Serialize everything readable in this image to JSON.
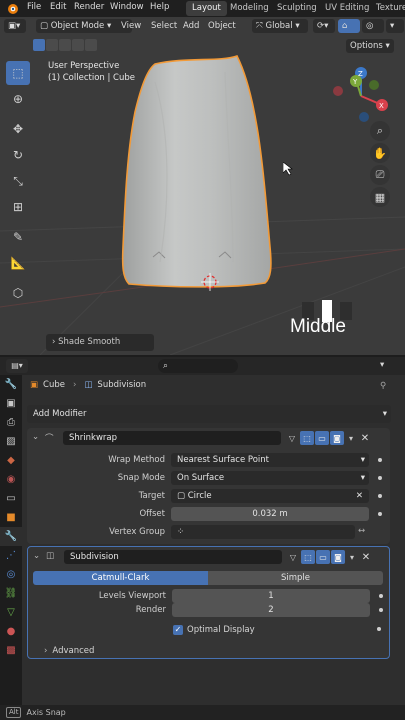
{
  "menu": [
    "File",
    "Edit",
    "Render",
    "Window",
    "Help"
  ],
  "workspaces": [
    "Layout",
    "Modeling",
    "Sculpting",
    "UV Editing",
    "Texture"
  ],
  "active_workspace": "Layout",
  "viewport": {
    "mode": "Object Mode",
    "header_menus": [
      "View",
      "Select",
      "Add",
      "Object"
    ],
    "transform": "Global",
    "options": "Options",
    "perspective": "User Perspective",
    "collection": "(1) Collection | Cube",
    "shade_panel": "Shade Smooth",
    "mouse_label": "Middle",
    "gizmo_axes": {
      "x": "X",
      "y": "Y",
      "z": "Z"
    }
  },
  "properties": {
    "breadcrumb_object": "Cube",
    "breadcrumb_modifier": "Subdivision",
    "add_modifier": "Add Modifier",
    "shrinkwrap": {
      "name": "Shrinkwrap",
      "wrap_method_label": "Wrap Method",
      "wrap_method": "Nearest Surface Point",
      "snap_mode_label": "Snap Mode",
      "snap_mode": "On Surface",
      "target_label": "Target",
      "target": "Circle",
      "offset_label": "Offset",
      "offset": "0.032 m",
      "vertex_group_label": "Vertex Group",
      "vertex_group": ""
    },
    "subdivision": {
      "name": "Subdivision",
      "tab_catmull": "Catmull-Clark",
      "tab_simple": "Simple",
      "levels_viewport_label": "Levels Viewport",
      "levels_viewport": "1",
      "render_label": "Render",
      "render": "2",
      "optimal_display": "Optimal Display",
      "advanced": "Advanced"
    }
  },
  "status": {
    "key": "Alt",
    "text": "Axis Snap"
  },
  "colors": {
    "accent": "#4772b3",
    "selection_outline": "#f29a38",
    "background": "#3b3b3b"
  }
}
